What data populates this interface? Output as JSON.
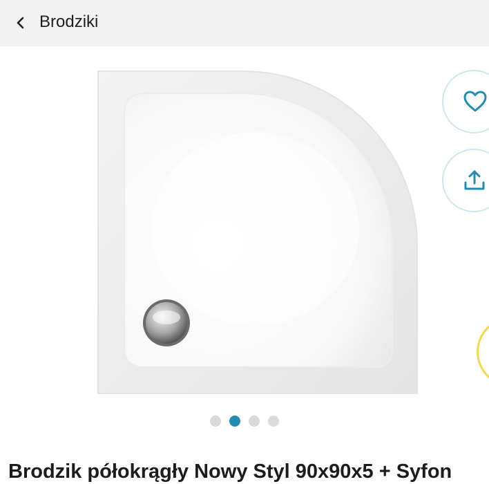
{
  "header": {
    "back_icon": "chevron-left-icon",
    "title": "Brodziki"
  },
  "gallery": {
    "image_subject": "white semicircular acrylic shower tray with chrome drain",
    "total_images": 4,
    "active_index": 1,
    "actions": {
      "favorite_icon": "heart-icon",
      "share_icon": "share-icon"
    }
  },
  "product": {
    "title": "Brodzik półokrągły Nowy Styl 90x90x5 + Syfon"
  },
  "colors": {
    "accent": "#1f8db3",
    "header_bg": "#f2f2f2",
    "dot_inactive": "#dadada",
    "fab_border": "#cfe6f0",
    "peek_ring": "#f6d84c"
  }
}
